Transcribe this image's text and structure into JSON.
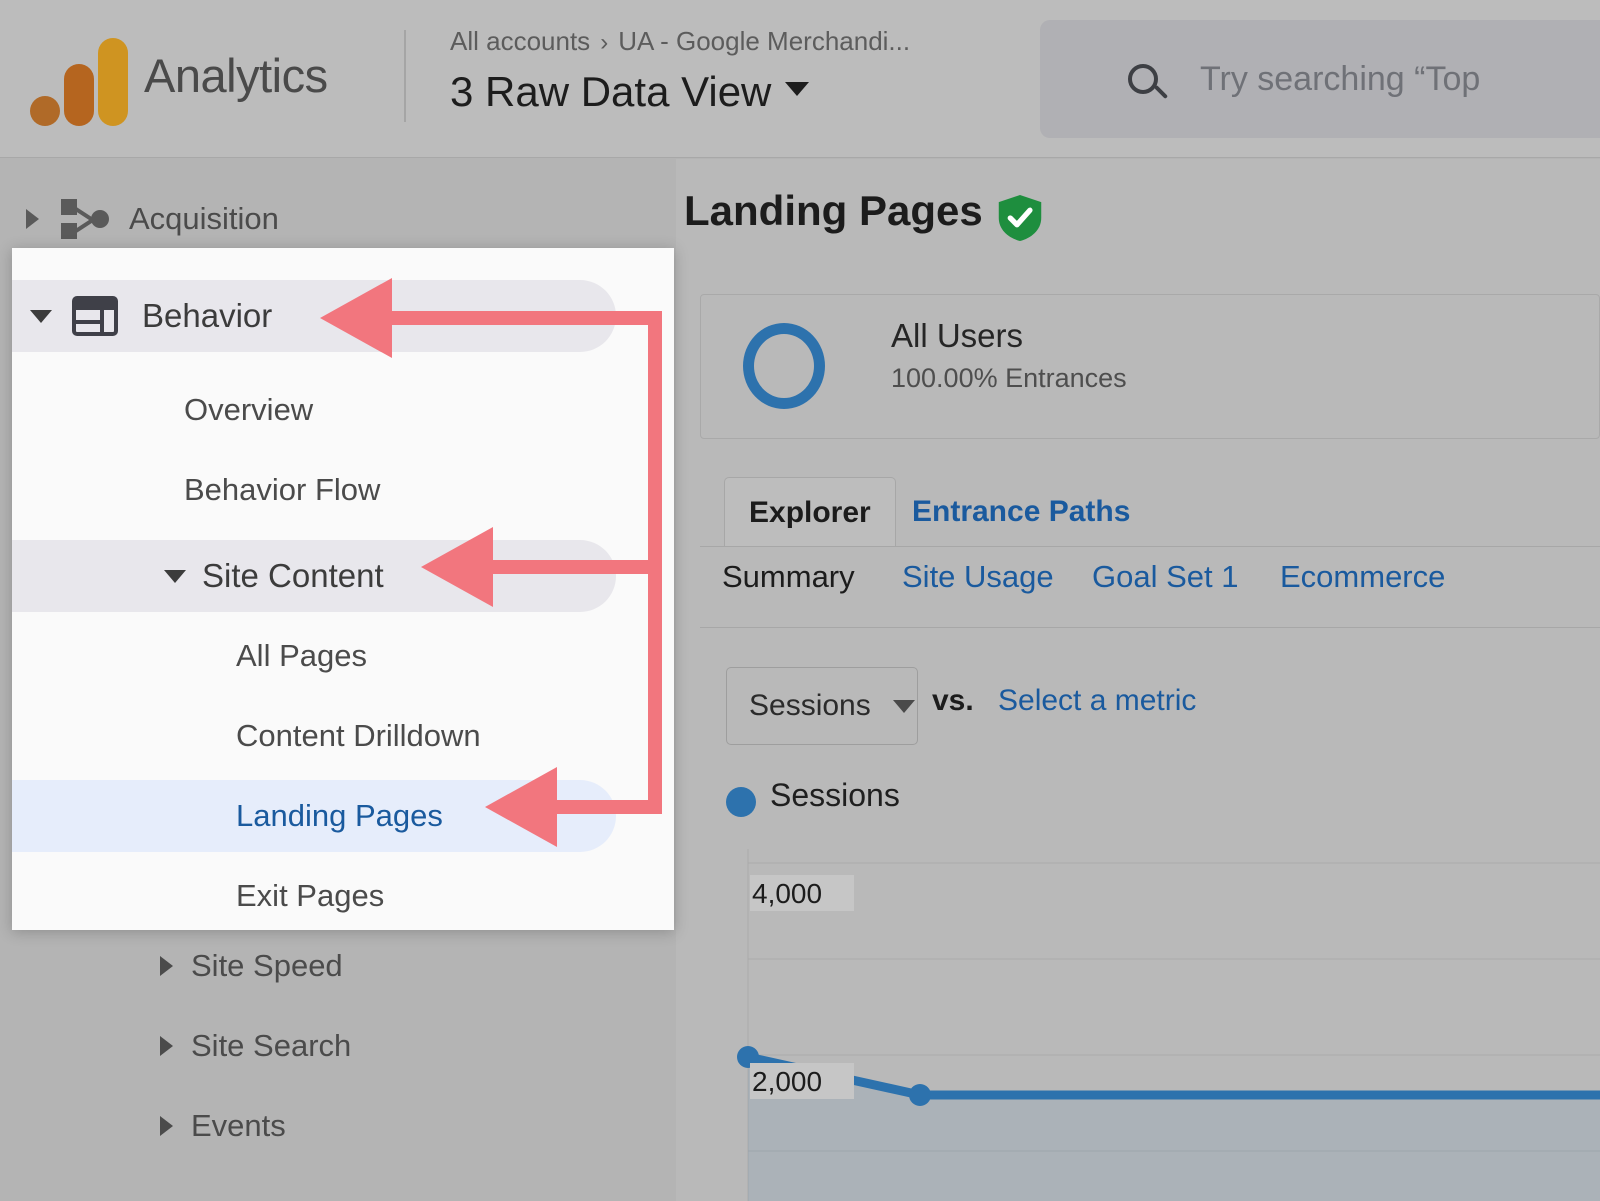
{
  "header": {
    "brand": "Analytics",
    "logo_icon": "analytics-logo-icon",
    "breadcrumb_account": "All accounts",
    "breadcrumb_separator": "›",
    "breadcrumb_property": "UA - Google Merchandi...",
    "view_name": "3 Raw Data View",
    "view_caret_icon": "chevron-down-icon",
    "search_icon": "search-icon",
    "search_placeholder": "Try searching “Top"
  },
  "sidebar": {
    "items": [
      {
        "label": "Acquisition",
        "icon": "share-network-icon",
        "expander": "chevron-right-icon"
      },
      {
        "label": "Site Speed",
        "expander": "chevron-right-icon"
      },
      {
        "label": "Site Search",
        "expander": "chevron-right-icon"
      },
      {
        "label": "Events",
        "expander": "chevron-right-icon"
      }
    ]
  },
  "popup_menu": {
    "behavior": {
      "label": "Behavior",
      "icon": "behavior-table-icon",
      "expander": "chevron-down-icon"
    },
    "items": [
      {
        "label": "Overview"
      },
      {
        "label": "Behavior Flow"
      },
      {
        "label": "Site Content",
        "expander": "chevron-down-icon",
        "highlight": "grey"
      },
      {
        "label": "All Pages"
      },
      {
        "label": "Content Drilldown"
      },
      {
        "label": "Landing Pages",
        "highlight": "blue",
        "selected": true
      },
      {
        "label": "Exit Pages"
      }
    ]
  },
  "annotations": {
    "arrow_color": "#F2767E",
    "targets": [
      "Behavior",
      "Site Content",
      "Landing Pages"
    ]
  },
  "main": {
    "page_title": "Landing Pages",
    "title_badge_icon": "green-shield-check-icon",
    "segment": {
      "name": "All Users",
      "sub": "100.00% Entrances",
      "ring_icon": "segment-ring-icon",
      "ring_color": "#2d72ad"
    },
    "tabs": [
      {
        "label": "Explorer",
        "active": true
      },
      {
        "label": "Entrance Paths",
        "active": false
      }
    ],
    "subtabs": [
      {
        "label": "Summary",
        "active": true
      },
      {
        "label": "Site Usage",
        "active": false
      },
      {
        "label": "Goal Set 1",
        "active": false
      },
      {
        "label": "Ecommerce",
        "active": false
      }
    ],
    "metric_selector": {
      "value": "Sessions",
      "caret_icon": "chevron-down-icon",
      "vs_label": "vs.",
      "compare_link": "Select a metric"
    },
    "legend": [
      {
        "label": "Sessions",
        "color": "#2d72ad"
      }
    ]
  },
  "chart_data": {
    "type": "line",
    "title": "",
    "xlabel": "",
    "ylabel": "",
    "series": [
      {
        "name": "Sessions",
        "color": "#2d72ad",
        "values": [
          2120,
          1720,
          1720,
          1720
        ]
      }
    ],
    "x": [
      0,
      1,
      2,
      3
    ],
    "ytick_labels": [
      "4,000",
      "2,000"
    ],
    "ytick_values": [
      4000,
      2000
    ],
    "ylim": [
      0,
      4400
    ],
    "grid": true,
    "legend_position": "top-left",
    "area_fill": true
  }
}
